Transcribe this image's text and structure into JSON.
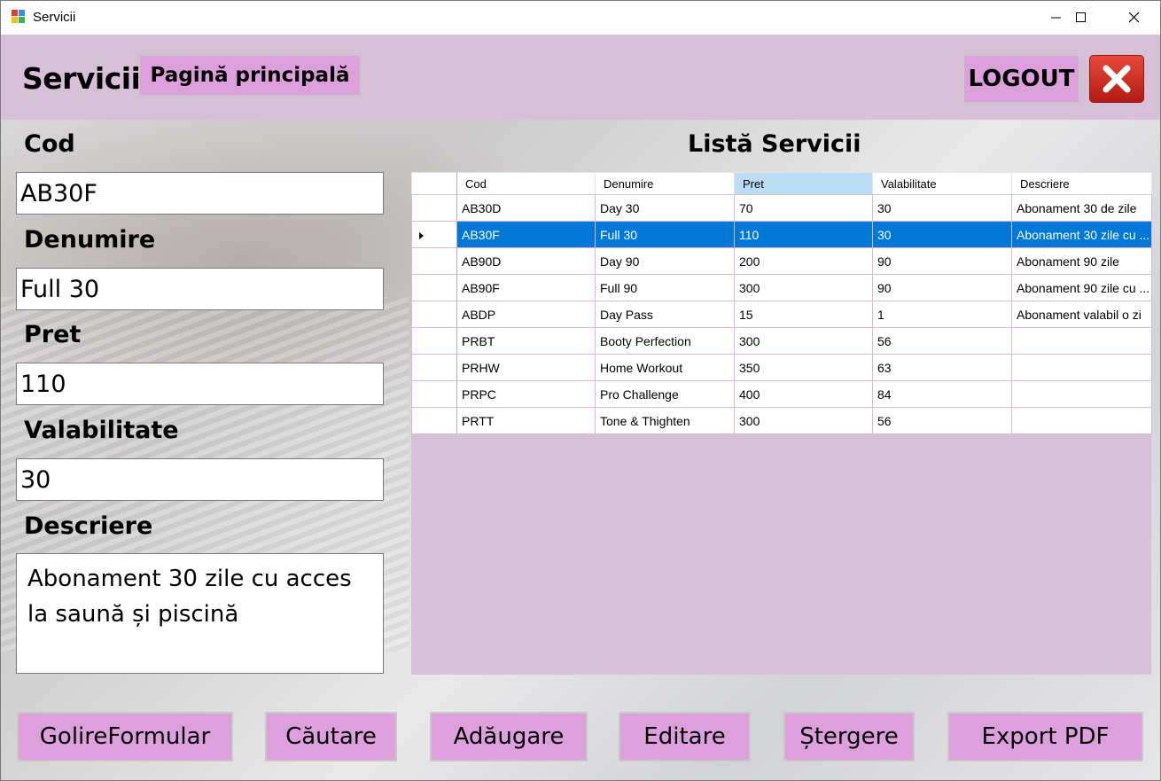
{
  "window": {
    "title": "Servicii"
  },
  "header": {
    "title": "Servicii",
    "home_button": "Pagină principală",
    "logout_button": "LOGOUT"
  },
  "form": {
    "cod": {
      "label": "Cod",
      "value": "AB30F"
    },
    "denumire": {
      "label": "Denumire",
      "value": "Full 30"
    },
    "pret": {
      "label": "Pret",
      "value": "110"
    },
    "valabilitate": {
      "label": "Valabilitate",
      "value": "30"
    },
    "descriere": {
      "label": "Descriere",
      "value": "Abonament 30 zile cu acces la saună și piscină"
    }
  },
  "list": {
    "title": "Listă Servicii",
    "columns": [
      "Cod",
      "Denumire",
      "Pret",
      "Valabilitate",
      "Descriere"
    ],
    "sorted_column": "Pret",
    "selected_row": 1,
    "rows": [
      [
        "AB30D",
        "Day 30",
        "70",
        "30",
        "Abonament 30 de zile"
      ],
      [
        "AB30F",
        "Full 30",
        "110",
        "30",
        "Abonament 30 zile cu ..."
      ],
      [
        "AB90D",
        "Day 90",
        "200",
        "90",
        "Abonament 90 zile"
      ],
      [
        "AB90F",
        "Full 90",
        "300",
        "90",
        "Abonament 90 zile cu ..."
      ],
      [
        "ABDP",
        "Day Pass",
        "15",
        "1",
        "Abonament valabil o zi"
      ],
      [
        "PRBT",
        "Booty Perfection",
        "300",
        "56",
        ""
      ],
      [
        "PRHW",
        "Home Workout",
        "350",
        "63",
        ""
      ],
      [
        "PRPC",
        "Pro Challenge",
        "400",
        "84",
        ""
      ],
      [
        "PRTT",
        "Tone & Thighten",
        "300",
        "56",
        ""
      ]
    ]
  },
  "actions": {
    "clear": "GolireFormular",
    "search": "Căutare",
    "add": "Adăugare",
    "edit": "Editare",
    "delete": "Ștergere",
    "export": "Export PDF"
  },
  "colors": {
    "header_bg": "#d8bfd8",
    "button_bg": "#dda0dd",
    "selection": "#0078d7",
    "exit_red": "#d0281c"
  }
}
